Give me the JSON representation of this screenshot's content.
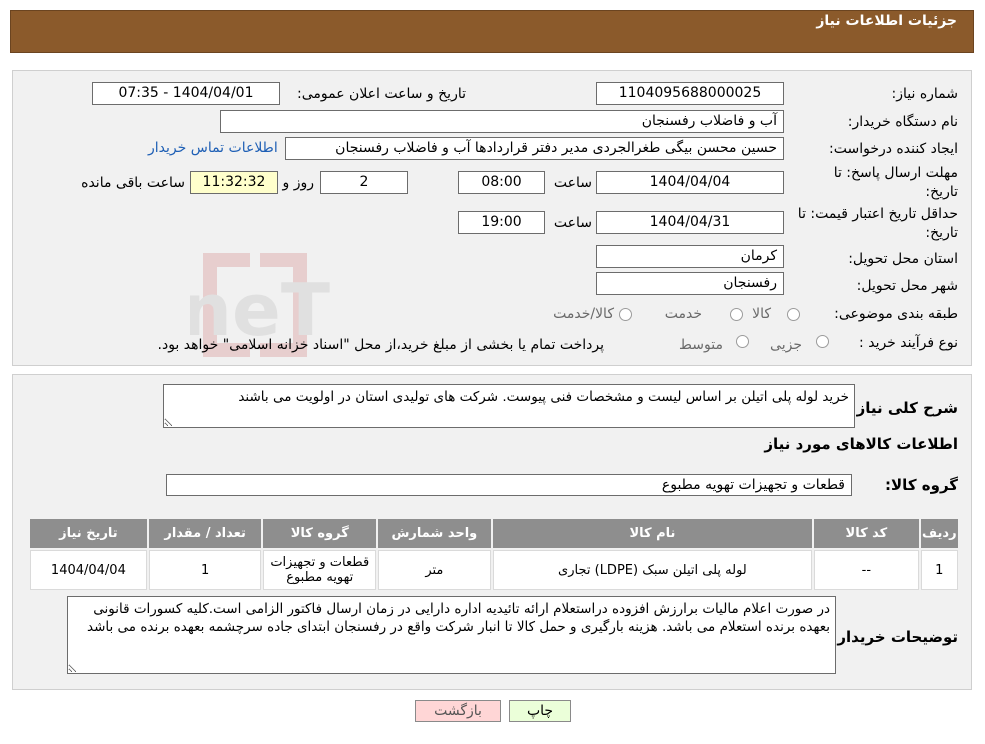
{
  "header": {
    "title": "جزئیات اطلاعات نیاز"
  },
  "form": {
    "need_number_label": "شماره نیاز:",
    "need_number": "1104095688000025",
    "announce_label": "تاریخ و ساعت اعلان عمومی:",
    "announce_value": "1404/04/01 - 07:35",
    "buyer_org_label": "نام دستگاه خریدار:",
    "buyer_org": "آب و فاضلاب رفسنجان",
    "creator_label": "ایجاد کننده درخواست:",
    "creator": "حسین محسن بیگی طغرالجردی مدیر دفتر قراردادها آب و فاضلاب رفسنجان",
    "contact_link": "اطلاعات تماس خریدار",
    "deadline_label_1": "مهلت ارسال پاسخ: تا",
    "deadline_label_2": "تاریخ:",
    "deadline_date": "1404/04/04",
    "time_label": "ساعت",
    "deadline_time": "08:00",
    "days_value": "2",
    "days_label": "روز و",
    "remaining_time": "11:32:32",
    "remaining_label": "ساعت باقی مانده",
    "validity_label_1": "حداقل تاریخ اعتبار قیمت: تا",
    "validity_label_2": "تاریخ:",
    "validity_date": "1404/04/31",
    "validity_time": "19:00",
    "province_label": "استان محل تحویل:",
    "province": "کرمان",
    "city_label": "شهر محل تحویل:",
    "city": "رفسنجان",
    "category_label": "طبقه بندی موضوعی:",
    "category_options": [
      "کالا",
      "خدمت",
      "کالا/خدمت"
    ],
    "purchase_type_label": "نوع فرآیند خرید :",
    "purchase_type_options": [
      "جزیی",
      "متوسط"
    ],
    "purchase_note": "پرداخت تمام یا بخشی از مبلغ خرید،از محل \"اسناد خزانه اسلامی\" خواهد بود."
  },
  "details": {
    "summary_label": "شرح کلی نیاز:",
    "summary": "خرید لوله پلی اتیلن بر اساس لیست و مشخصات فنی پیوست. شرکت های تولیدی استان در اولویت می باشند",
    "goods_info_title": "اطلاعات کالاهای مورد نیاز",
    "goods_group_label": "گروه کالا:",
    "goods_group": "قطعات و تجهیزات تهویه مطبوع",
    "table": {
      "headers": [
        "ردیف",
        "کد کالا",
        "نام کالا",
        "واحد شمارش",
        "گروه کالا",
        "تعداد / مقدار",
        "تاریخ نیاز"
      ],
      "rows": [
        [
          "1",
          "--",
          "لوله پلی اتیلن سبک (LDPE) تجاری",
          "متر",
          "قطعات و تجهیزات تهویه مطبوع",
          "1",
          "1404/04/04"
        ]
      ]
    },
    "buyer_notes_label": "توضیحات خریدار:",
    "buyer_notes": "در صورت اعلام مالیات برارزش افزوده دراستعلام ارائه تائیدیه اداره دارایی در زمان ارسال فاکتور الزامی است.کلیه کسورات قانونی بعهده برنده استعلام می باشد. هزینه بارگیری و حمل کالا تا انبار شرکت واقع در رفسنجان ابتدای جاده سرچشمه بعهده برنده می باشد"
  },
  "buttons": {
    "print": "چاپ",
    "back": "بازگشت"
  },
  "watermark": {
    "text": "AriaTender.neT"
  },
  "colors": {
    "header_bg": "#8b5a2b",
    "link": "#1e5fb5",
    "print_btn": "#ebffd9",
    "back_btn": "#ffd6d6",
    "table_header": "#8e8e8e"
  }
}
